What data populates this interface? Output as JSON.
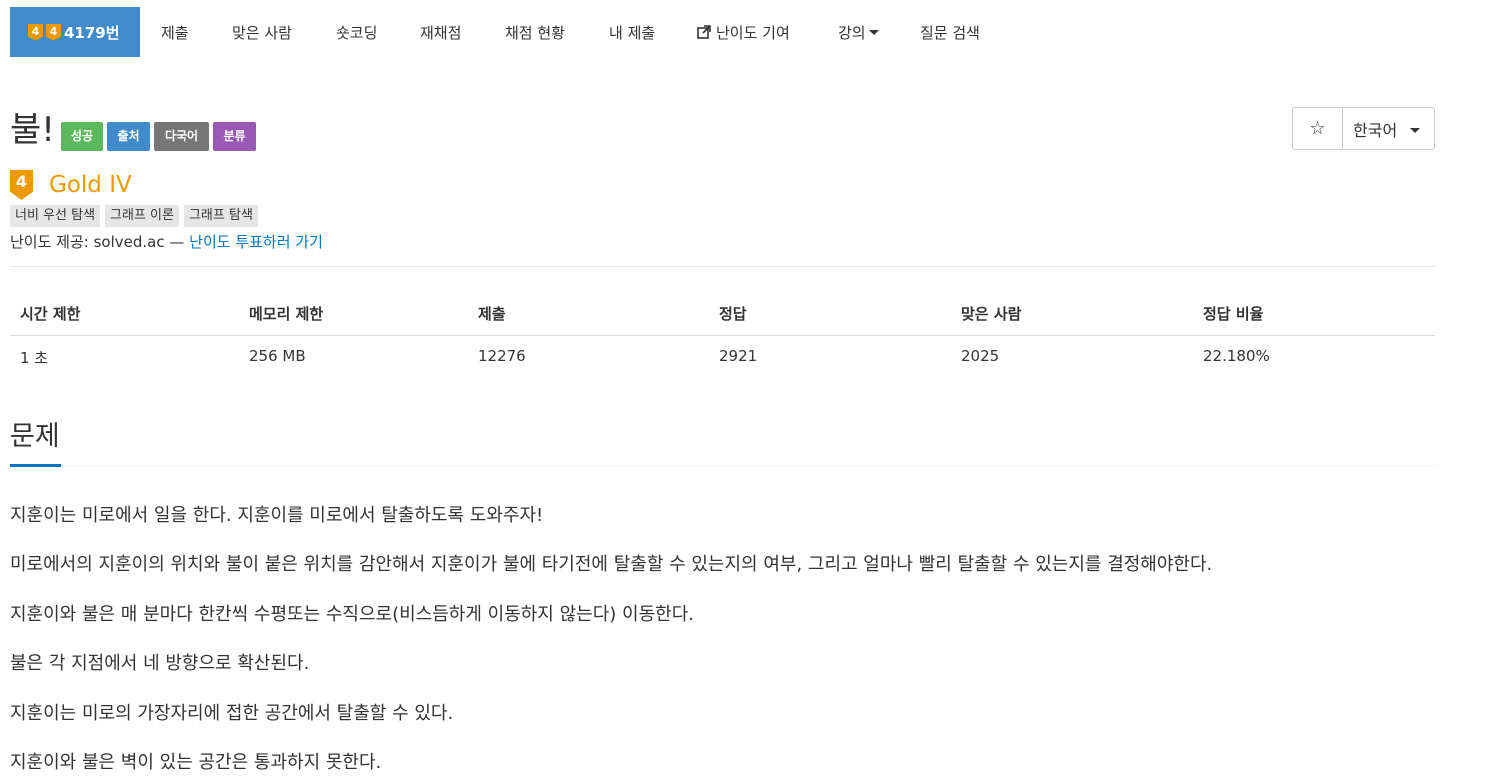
{
  "nav": {
    "active_tier": "4",
    "active_tier2": "4",
    "active_label": "4179번",
    "items": [
      "제출",
      "맞은 사람",
      "숏코딩",
      "재채점",
      "채점 현황",
      "내 제출",
      "난이도 기여",
      "강의",
      "질문 검색"
    ]
  },
  "problem": {
    "title": "불!",
    "labels": [
      "성공",
      "출처",
      "다국어",
      "분류"
    ],
    "star": "☆",
    "language": "한국어",
    "tier_number": "4",
    "tier": "Gold IV",
    "tags": [
      "너비 우선 탐색",
      "그래프 이론",
      "그래프 탐색"
    ],
    "credit_prefix": "난이도 제공: solved.ac —",
    "credit_link": "난이도 투표하러 가기"
  },
  "stats": {
    "headers": [
      "시간 제한",
      "메모리 제한",
      "제출",
      "정답",
      "맞은 사람",
      "정답 비율"
    ],
    "values": [
      "1 초",
      "256 MB",
      "12276",
      "2921",
      "2025",
      "22.180%"
    ]
  },
  "section": {
    "title": "문제",
    "paragraphs": [
      "지훈이는 미로에서 일을 한다. 지훈이를 미로에서 탈출하도록 도와주자!",
      "미로에서의 지훈이의 위치와 불이 붙은 위치를 감안해서 지훈이가 불에 타기전에 탈출할 수 있는지의 여부, 그리고 얼마나 빨리 탈출할 수 있는지를 결정해야한다.",
      "지훈이와 불은 매 분마다 한칸씩 수평또는 수직으로(비스듬하게 이동하지 않는다)  이동한다.",
      "불은 각 지점에서 네 방향으로 확산된다.",
      "지훈이는 미로의 가장자리에 접한 공간에서 탈출할 수 있다.",
      "지훈이와 불은 벽이 있는 공간은 통과하지 못한다."
    ]
  },
  "colors": {
    "nav_active": "#428bca",
    "label_success": "#5cb85c",
    "label_source": "#428bca",
    "label_multilang": "#777777",
    "label_category": "#9b59b6",
    "gold": "#ec9a00",
    "link": "#0076c0"
  }
}
